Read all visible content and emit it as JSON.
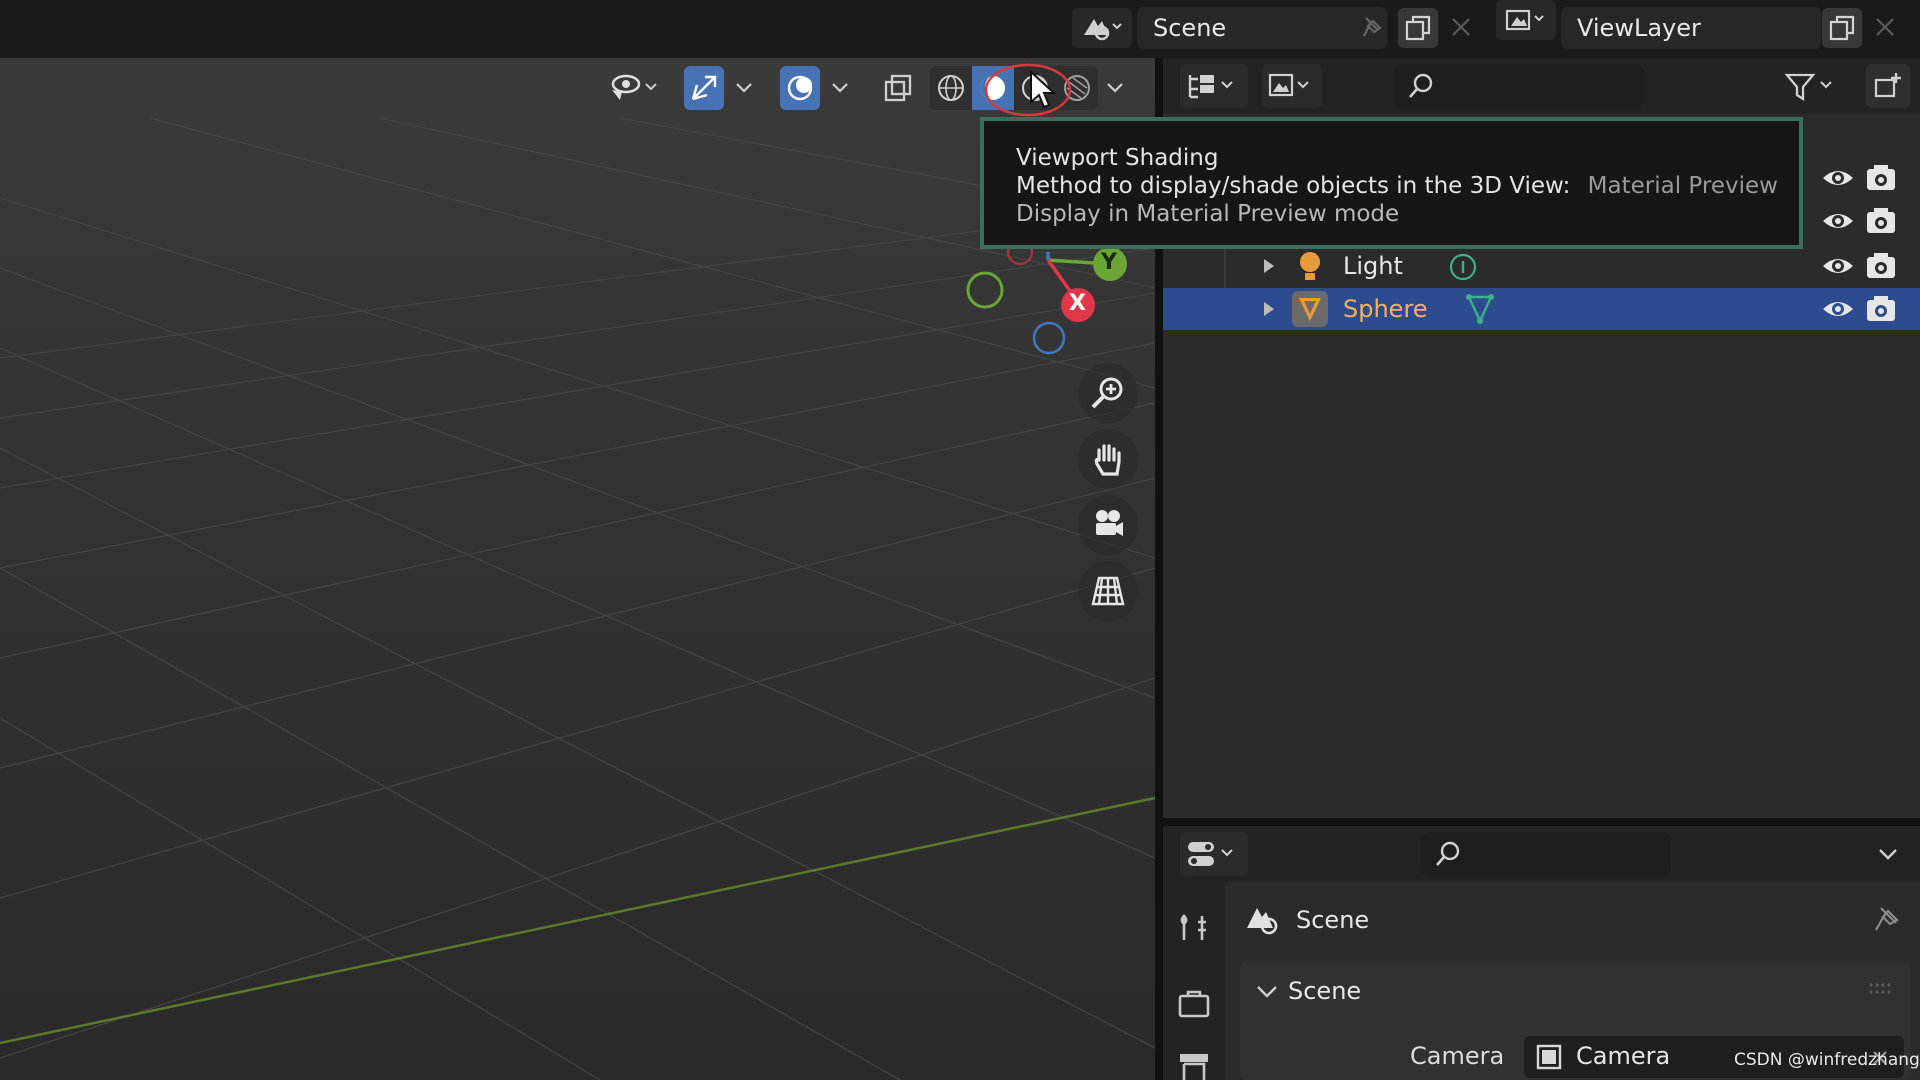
{
  "header": {
    "scene_label": "Scene",
    "viewlayer_label": "ViewLayer"
  },
  "viewport": {
    "gizmo": {
      "y_label": "Y",
      "x_label": "X"
    },
    "nav_icons": [
      "zoom-icon",
      "hand-pan-icon",
      "camera-view-icon",
      "grid-ortho-icon"
    ]
  },
  "tooltip": {
    "title": "Viewport Shading",
    "method_label": "Method to display/shade objects in the 3D View:",
    "method_value": "Material Preview",
    "description": "Display in Material Preview mode"
  },
  "outliner": {
    "items": [
      {
        "label": "Light",
        "selected": false
      },
      {
        "label": "Sphere",
        "selected": true
      }
    ]
  },
  "properties": {
    "breadcrumb": "Scene",
    "panel_title": "Scene",
    "camera_label": "Camera",
    "camera_value": "Camera"
  },
  "watermark": "CSDN @winfredzhang",
  "colors": {
    "accent_selection": "#2d4c8f",
    "tooltip_border": "#3b6e5c",
    "y_axis": "#6aa636",
    "x_axis": "#e2364b",
    "light_orange": "#e89b3a"
  }
}
